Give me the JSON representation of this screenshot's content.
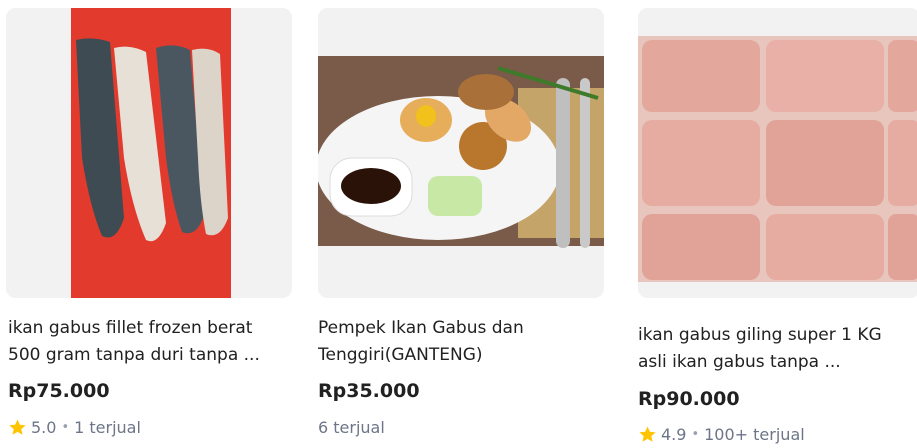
{
  "products": [
    {
      "title_line1": "ikan gabus fillet frozen berat",
      "title_line2": "500 gram tanpa duri tanpa ...",
      "price": "Rp75.000",
      "rating": "5.0",
      "sold": "1 terjual",
      "image_icon": "fish-fillet-image"
    },
    {
      "title_line1": "Pempek Ikan Gabus dan",
      "title_line2": "Tenggiri(GANTENG)",
      "price": "Rp35.000",
      "rating": "",
      "sold": "6 terjual",
      "image_icon": "pempek-dish-image"
    },
    {
      "title_line1": "ikan gabus giling super 1 KG",
      "title_line2": "asli ikan gabus tanpa ...",
      "price": "Rp90.000",
      "rating": "4.9",
      "sold": "100+ terjual",
      "image_icon": "minced-fish-image"
    }
  ],
  "colors": {
    "star": "#ffc400",
    "meta_text": "#6d7588",
    "price": "#212121"
  }
}
